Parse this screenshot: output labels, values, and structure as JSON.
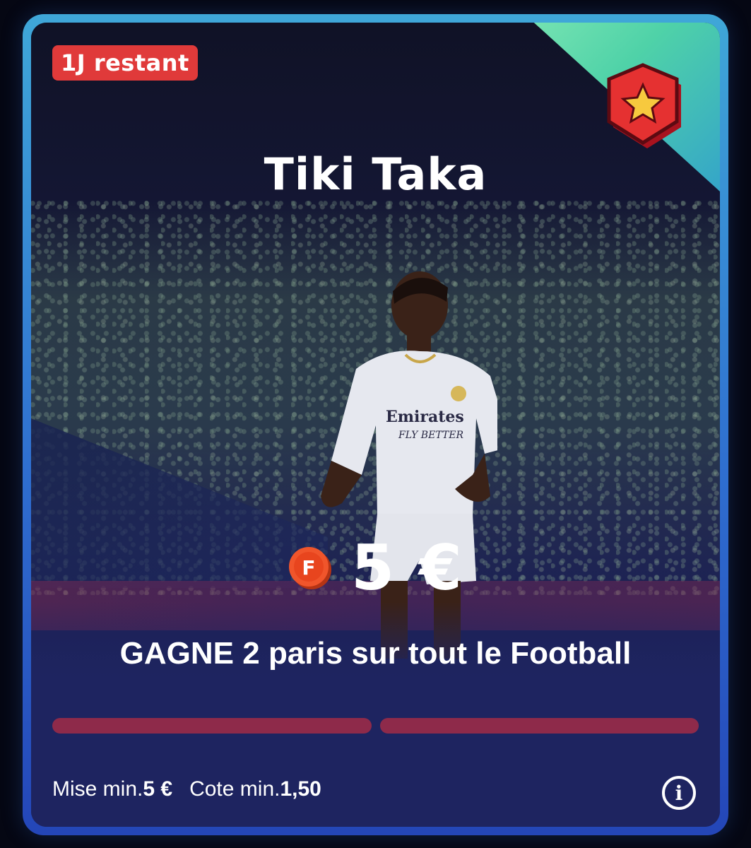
{
  "badge": {
    "label": "1J restant"
  },
  "challenge": {
    "title": "Tiki Taka",
    "reward_amount": "5 €",
    "coin_icon_letter": "F",
    "description": "GAGNE 2 paris sur tout le Football"
  },
  "progress": {
    "completed": 0,
    "total": 2
  },
  "footer": {
    "min_stake_label": "Mise min.",
    "min_stake_value": "5 €",
    "min_odds_label": "Cote min.",
    "min_odds_value": "1,50"
  },
  "icons": {
    "star_badge": "star-badge-icon",
    "coin": "coin-icon",
    "info": "info-icon"
  },
  "colors": {
    "badge_red": "#e03a3a",
    "progress_empty": "#8e2a4a",
    "card_bg": "#1e2460",
    "border_gradient_top": "#3fa7d8",
    "corner_green": "#4fd2a8"
  }
}
